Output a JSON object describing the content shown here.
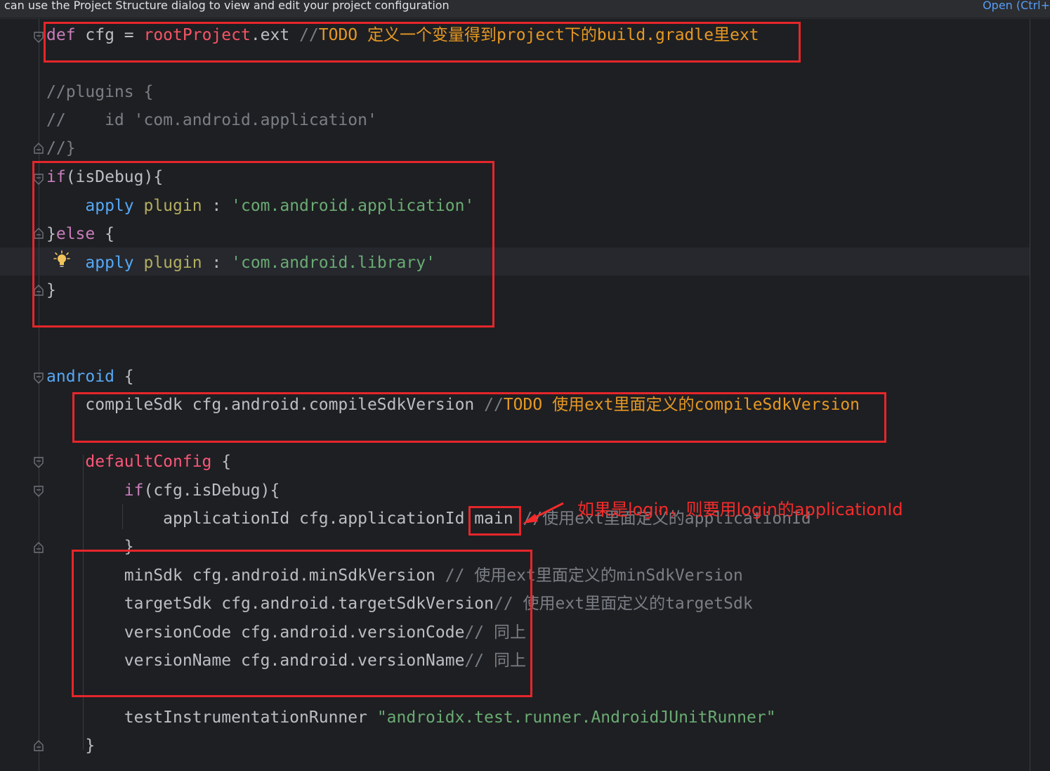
{
  "notification": {
    "message": "can use the Project Structure dialog to view and edit your project configuration",
    "open_link": "Open (Ctrl+"
  },
  "code": {
    "l1": {
      "kw": "def",
      "sp": " cfg = ",
      "root": "rootProject",
      "ext": ".ext ",
      "slash": "//",
      "todo": "TODO 定义一个变量得到project下的build.gradle里ext"
    },
    "l3": "//plugins {",
    "l4": "//    id 'com.android.application'",
    "l5": "//}",
    "l6": {
      "kw": "if",
      "rest": "(isDebug){"
    },
    "l7": {
      "ind": "    ",
      "apply": "apply",
      "plugin": " plugin",
      "colon": " : ",
      "str": "'com.android.application'"
    },
    "l8": {
      "brace": "}",
      "kw": "else",
      "rest": " {"
    },
    "l9": {
      "ind": "    ",
      "apply": "apply",
      "plugin": " plugin",
      "colon": " : ",
      "str": "'com.android.library'"
    },
    "l10": "}",
    "l13": {
      "kw": "android",
      "rest": " {"
    },
    "l14": {
      "ind": "    ",
      "code": "compileSdk cfg.android.compileSdkVersion ",
      "slash": "//",
      "todo": "TODO 使用ext里面定义的compileSdkVersion"
    },
    "l16": {
      "ind": "    ",
      "name": "defaultConfig",
      "rest": " {"
    },
    "l17": {
      "ind": "        ",
      "kw": "if",
      "rest": "(cfg.isDebug){"
    },
    "l18": {
      "ind": "            ",
      "code": "applicationId cfg.applicationId",
      "main": ".main",
      "comment": " //使用ext里面定义的applicationId"
    },
    "l19": {
      "ind": "        ",
      "brace": "}"
    },
    "l20": {
      "ind": "        ",
      "code": "minSdk cfg.android.minSdkVersion ",
      "comment": "// 使用ext里面定义的minSdkVersion"
    },
    "l21": {
      "ind": "        ",
      "code": "targetSdk cfg.android.targetSdkVersion",
      "comment": "// 使用ext里面定义的targetSdk"
    },
    "l22": {
      "ind": "        ",
      "code": "versionCode cfg.android.versionCode",
      "comment": "// 同上"
    },
    "l23": {
      "ind": "        ",
      "code": "versionName cfg.android.versionName",
      "comment": "// 同上"
    },
    "l25": {
      "ind": "        ",
      "code": "testInstrumentationRunner ",
      "str": "\"androidx.test.runner.AndroidJUnitRunner\""
    },
    "l26": {
      "ind": "    ",
      "brace": "}"
    }
  },
  "annotation": {
    "text": "如果是login，则要用login的applicationId",
    "color": "#f52b2b"
  },
  "colors": {
    "background": "#1e1f22",
    "keyword": "#c77dbb",
    "function": "#56a8f5",
    "string": "#6aab73",
    "comment": "#7a7e85",
    "todo": "#e69823",
    "highlight_box": "#e5262b"
  },
  "icons": {
    "fold": "fold-marker-icon",
    "intention": "lightbulb-icon"
  }
}
